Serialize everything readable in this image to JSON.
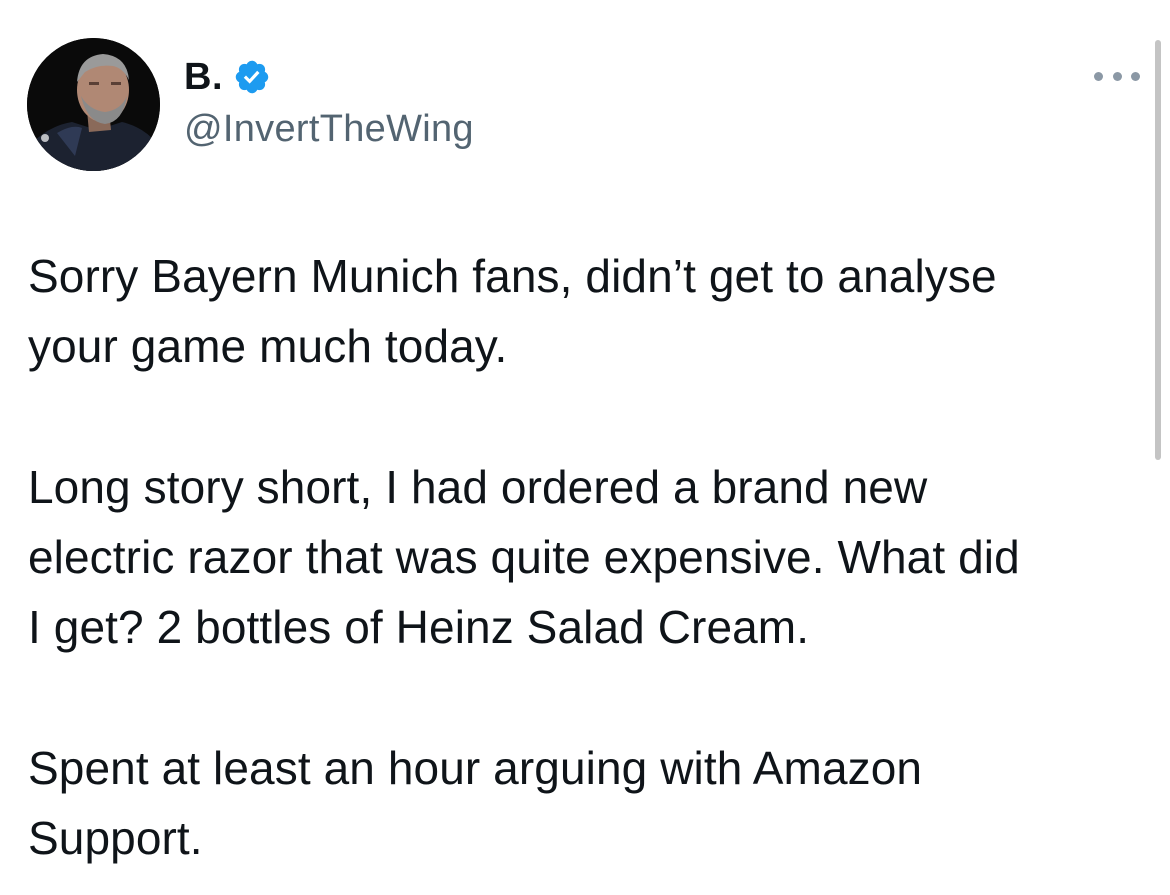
{
  "author": {
    "display_name": "B.",
    "handle": "@InvertTheWing",
    "verified": true,
    "avatar_icon": "avatar-photo",
    "badge_color": "#1d9bf0"
  },
  "menu": {
    "more_icon": "more-horizontal-icon"
  },
  "tweet": {
    "paragraphs": [
      {
        "lines": [
          "Sorry Bayern Munich fans, didn’t get to analyse",
          "your game much today."
        ]
      },
      {
        "lines": [
          "Long story short, I had ordered a brand new",
          "electric razor that was quite expensive. What did",
          "I get? 2 bottles of Heinz Salad Cream."
        ]
      },
      {
        "lines": [
          "Spent at least an hour arguing with Amazon",
          "Support."
        ]
      }
    ]
  },
  "colors": {
    "text": "#0f1419",
    "secondary_text": "#536471",
    "background": "#ffffff"
  }
}
